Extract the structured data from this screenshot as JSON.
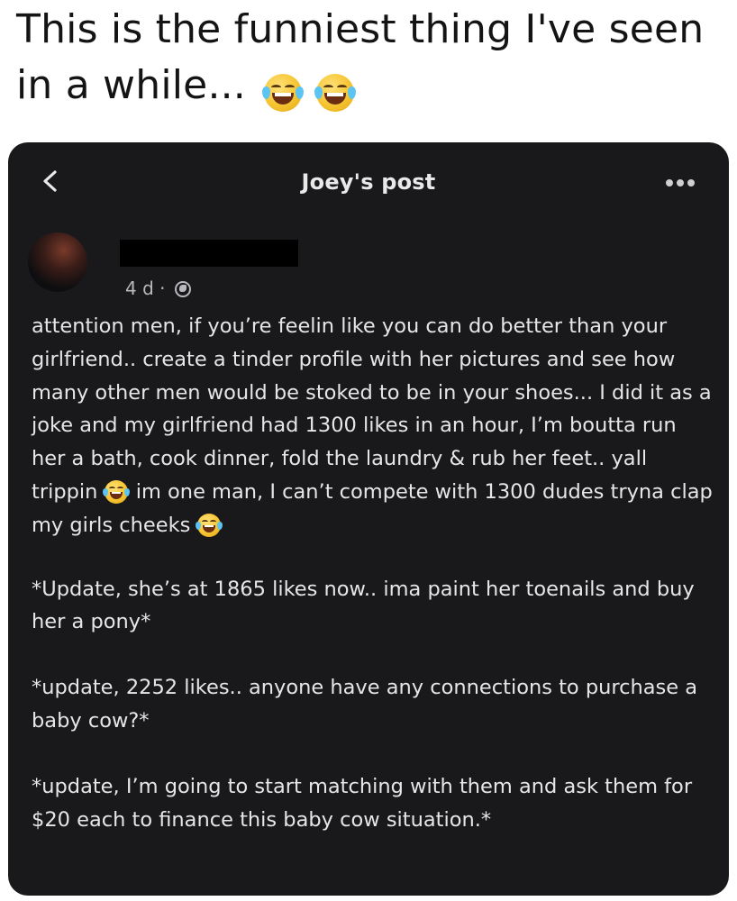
{
  "caption": {
    "text": "This is the funniest thing I've seen in a while...",
    "emoji": [
      "face-with-tears-of-joy-icon",
      "face-with-tears-of-joy-icon"
    ]
  },
  "post": {
    "nav_title": "Joey's post",
    "timestamp": "4 d ·",
    "paragraph1_a": "attention men, if you’re feelin like you can do better than your girlfriend.. create a tinder profile with her pictures and see how many other men would be stoked to be in your shoes... I did it as a joke and my girlfriend had 1300 likes in an hour, I’m boutta run her a bath, cook dinner, fold the laundry & rub her feet.. yall trippin",
    "paragraph1_b": " im one man, I can’t compete with 1300 dudes tryna clap my girls cheeks ",
    "update1": "*Update, she’s at 1865 likes now.. ima paint her toenails and buy her a pony*",
    "update2": "*update, 2252 likes.. anyone have any connections to purchase a baby cow?*",
    "update3": "*update, I’m going to start matching with them and ask them for $20 each to finance this baby cow situation.*"
  },
  "colors": {
    "post_background": "#19191b",
    "post_text": "#e6e6e8",
    "meta_text": "#b9b9bd"
  }
}
